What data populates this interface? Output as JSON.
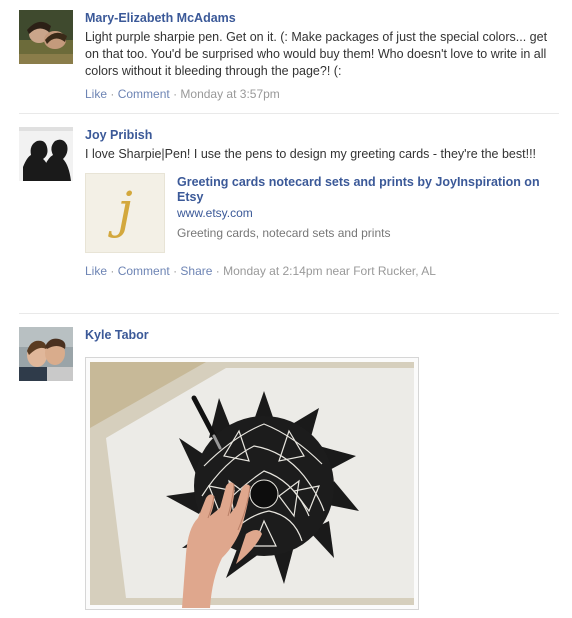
{
  "posts": [
    {
      "author": "Mary-Elizabeth McAdams",
      "message": "Light purple sharpie pen. Get on it. (: Make packages of just the special colors... get on that too. You'd be surprised who would buy them! Who doesn't love to write in all colors without it bleeding through the page?! (:",
      "actions": {
        "like": "Like",
        "comment": "Comment",
        "separator": "·",
        "timestamp": "Monday at 3:57pm"
      }
    },
    {
      "author": "Joy Pribish",
      "message": "I love Sharpie|Pen! I use the pens to design my greeting cards - they're the best!!!",
      "attachment": {
        "thumb_letter": "j",
        "title": "Greeting cards notecard sets and prints by JoyInspiration on Etsy",
        "url": "www.etsy.com",
        "description": "Greeting cards, notecard sets and prints"
      },
      "actions": {
        "like": "Like",
        "comment": "Comment",
        "share": "Share",
        "separator": "·",
        "timestamp": "Monday at 2:14pm near Fort Rucker, AL"
      }
    },
    {
      "author": "Kyle Tabor"
    }
  ],
  "colors": {
    "link": "#3b5998",
    "action_link": "#6d84b4",
    "muted": "#999999",
    "divider": "#e9e9e9"
  }
}
